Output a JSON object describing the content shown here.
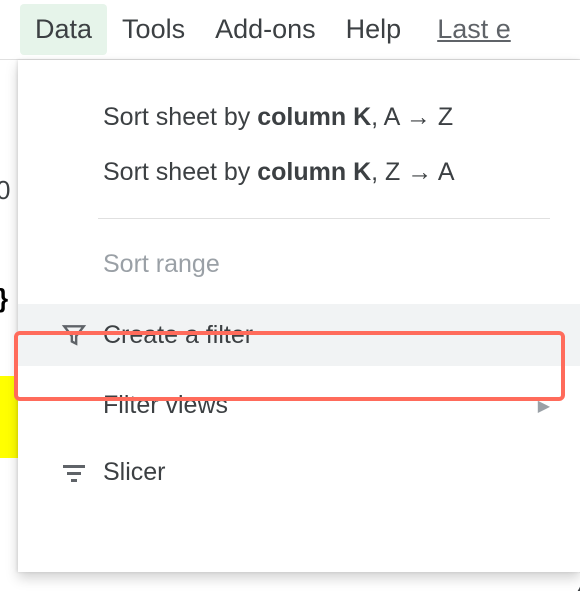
{
  "menubar": {
    "items": [
      {
        "label": "Data",
        "active": true
      },
      {
        "label": "Tools",
        "active": false
      },
      {
        "label": "Add-ons",
        "active": false
      },
      {
        "label": "Help",
        "active": false
      }
    ],
    "last_edit": "Last e"
  },
  "dropdown": {
    "sort1_prefix": "Sort sheet by ",
    "sort1_bold": "column K",
    "sort1_suffix": ", A → Z",
    "sort2_prefix": "Sort sheet by ",
    "sort2_bold": "column K",
    "sort2_suffix": ", Z → A",
    "sort_range": "Sort range",
    "create_filter": "Create a filter",
    "filter_views": "Filter views",
    "slicer": "Slicer"
  },
  "side": {
    "cell_hint": "0",
    "dot_char": "}",
    "right_paren": ")"
  }
}
